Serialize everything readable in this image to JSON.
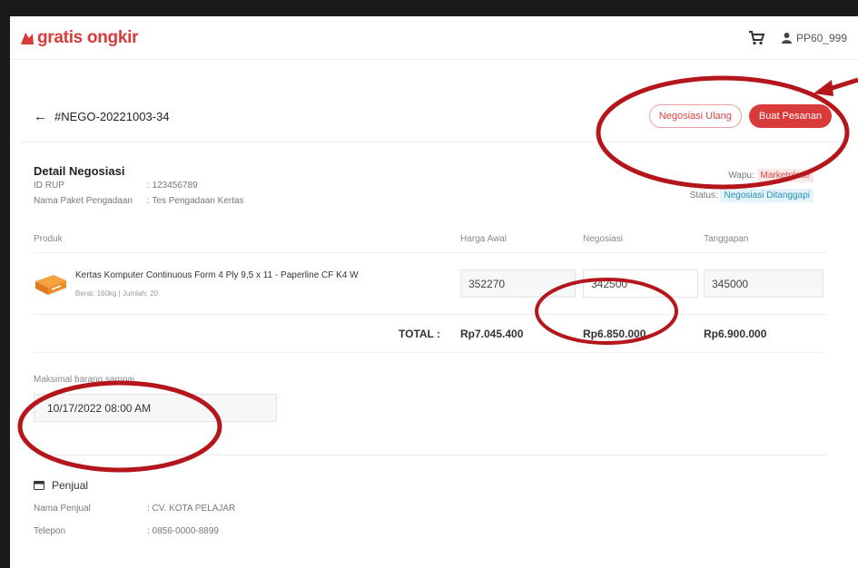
{
  "app": {
    "logo_text": "gratis ongkir",
    "username": "PP60_999"
  },
  "header": {
    "title": "#NEGO-20221003-34",
    "renegotiate_label": "Negosiasi Ulang",
    "order_label": "Buat Pesanan"
  },
  "detail": {
    "title": "Detail Negosiasi",
    "rup_key": "ID RUP",
    "rup_value": ": 123456789",
    "package_key": "Nama Paket Pengadaan",
    "package_value": ": Tes Pengadaan Kertas",
    "wapu_label": "Wapu:",
    "wapu_value": "Marketplace",
    "status_label": "Status:",
    "status_value": "Negosiasi Ditanggapi"
  },
  "table": {
    "headers": [
      "Produk",
      "Harga Awal",
      "Negosiasi",
      "Tanggapan"
    ],
    "product_name": "Kertas Komputer Continuous Form 4 Ply 9,5 x 11 - Paperline CF K4 W",
    "product_meta": "Berat: 160kg | Jumlah: 20",
    "harga_awal": "352270",
    "negosiasi": "342500",
    "tanggapan": "345000",
    "total_label": "TOTAL :",
    "total_awal": "Rp7.045.400",
    "total_nego": "Rp6.850.000",
    "total_tanggapan": "Rp6.900.000"
  },
  "delivery": {
    "label": "Maksimal barang sampai",
    "value": "10/17/2022 08:00 AM"
  },
  "seller": {
    "title": "Penjual",
    "name_key": "Nama Penjual",
    "name_value": ": CV. KOTA PELAJAR",
    "phone_key": "Telepon",
    "phone_value": ": 0856-0000-8899"
  },
  "colors": {
    "brand": "#d93a3a",
    "annotation": "#b5161b"
  },
  "icons": [
    "cart-icon",
    "user-icon",
    "back-arrow-icon",
    "store-icon"
  ]
}
